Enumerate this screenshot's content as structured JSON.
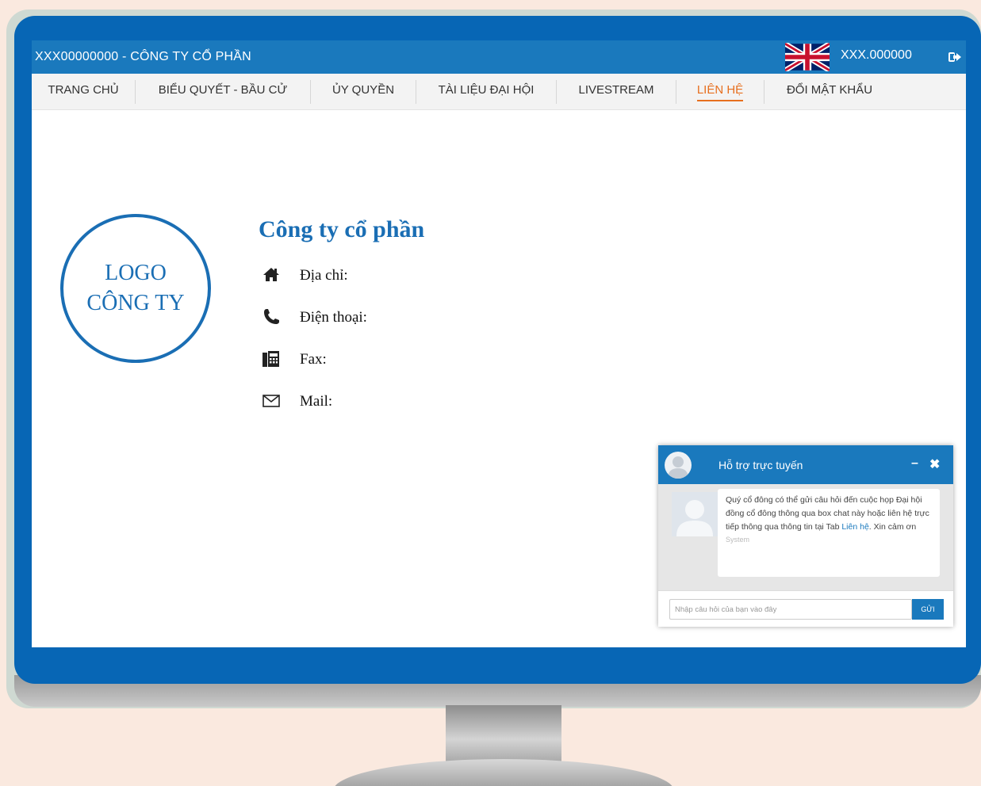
{
  "header": {
    "title": "XXX00000000 - CÔNG TY CỔ PHẦN",
    "user_code": "XXX.000000",
    "language_flag": "uk-flag-icon",
    "logout_icon": "logout-icon"
  },
  "nav": {
    "items": [
      {
        "label": "TRANG CHỦ"
      },
      {
        "label": "BIỂU QUYẾT - BẦU CỬ"
      },
      {
        "label": "ỦY QUYỀN"
      },
      {
        "label": "TÀI LIỆU ĐẠI HỘI"
      },
      {
        "label": "LIVESTREAM"
      },
      {
        "label": "LIÊN HỆ"
      },
      {
        "label": "ĐỔI MẬT KHẨU"
      }
    ],
    "active": "LIÊN HỆ"
  },
  "contact": {
    "logo_line1": "LOGO",
    "logo_line2": "CÔNG TY",
    "company_name": "Công ty cổ phần",
    "address_label": "Địa chỉ:",
    "phone_label": "Điện thoại:",
    "fax_label": "Fax:",
    "mail_label": "Mail:"
  },
  "chat": {
    "title": "Hỗ trợ trực tuyến",
    "minimize": "–",
    "close": "✖",
    "message_before_link": "Quý cổ đông có thể gửi câu hỏi đến cuộc họp Đại hội đồng cổ đông thông qua box chat này hoặc liên hệ trực tiếp thông qua thông tin tại Tab ",
    "message_link": "Liên hệ",
    "message_after_link": ". Xin cảm ơn",
    "sender": "System",
    "input_placeholder": "Nhập câu hỏi của bạn vào đây",
    "send_label": "GỬI"
  },
  "colors": {
    "primary": "#1a79bd",
    "frame": "#0766b5",
    "active_tab": "#e76f1e",
    "accent_text": "#1a6eb4"
  }
}
